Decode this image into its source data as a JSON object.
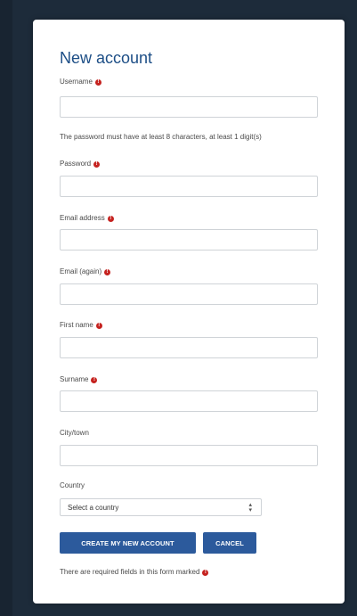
{
  "form": {
    "title": "New account",
    "password_hint": "The password must have at least 8 characters, at least 1 digit(s)",
    "required_icon": "!",
    "fields": {
      "username": {
        "label": "Username",
        "value": ""
      },
      "password": {
        "label": "Password",
        "value": ""
      },
      "email": {
        "label": "Email address",
        "value": ""
      },
      "email_again": {
        "label": "Email (again)",
        "value": ""
      },
      "first_name": {
        "label": "First name",
        "value": ""
      },
      "surname": {
        "label": "Surname",
        "value": ""
      },
      "city": {
        "label": "City/town",
        "value": ""
      }
    },
    "country": {
      "label": "Country",
      "selected": "Select a country"
    },
    "buttons": {
      "create": "CREATE MY NEW ACCOUNT",
      "cancel": "CANCEL"
    },
    "footer_note": "There are required fields in this form marked"
  },
  "colors": {
    "page_background": "#1d2b3a",
    "title": "#1d4e86",
    "button": "#2c5a9c",
    "required": "#c5221f"
  },
  "icons": {
    "required": "exclamation-circle-icon",
    "select_arrow": "up-down-chevron-icon"
  }
}
